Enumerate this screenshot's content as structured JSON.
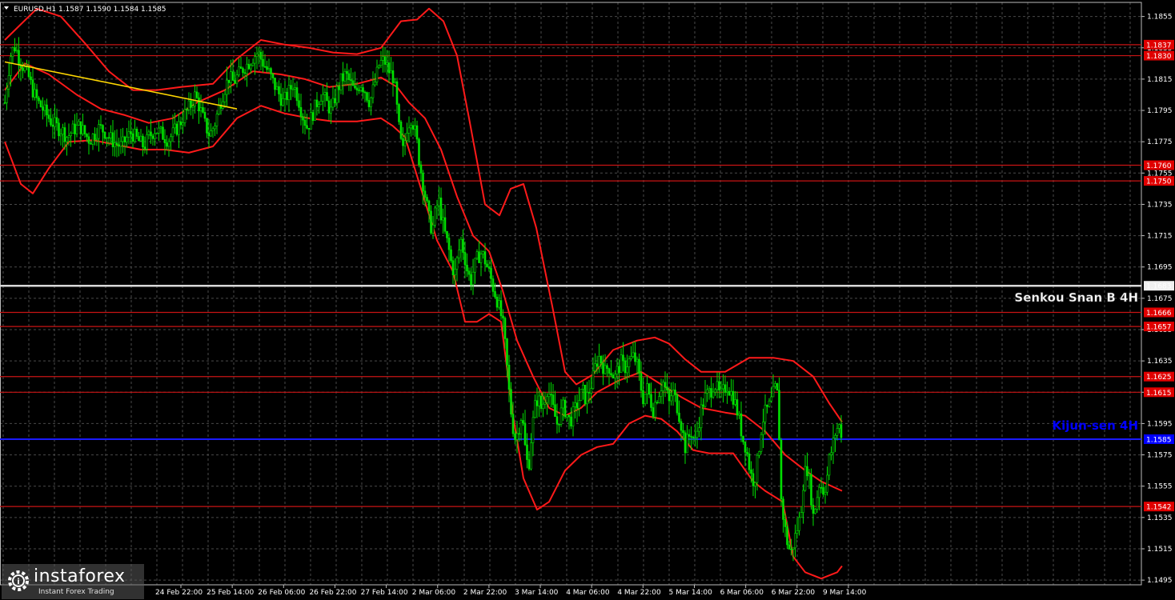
{
  "header": {
    "label": "EURUSD,H1  1.1587 1.1590 1.1584 1.1585",
    "menu_icon": "triangle-down-icon"
  },
  "colors": {
    "background": "#000000",
    "grid": "#4a4a4a",
    "candles": "#00e000",
    "bands": "#ff1a1a",
    "levels": "#c81414",
    "trendline": "#ffd700",
    "senkou": "#d9d9d9",
    "kijun": "#1a1aff",
    "badge_red": "#e00000",
    "badge_white": "#f0f0f0",
    "badge_blue": "#0000ff"
  },
  "watermark": {
    "brand": "instaforex",
    "tagline": "Instant Forex Trading",
    "icon": "instaforex-gear-logo-icon"
  },
  "chart_data": {
    "type": "candlestick",
    "symbol": "EURUSD",
    "timeframe": "H1",
    "ylim": [
      1.1492,
      1.1864
    ],
    "grid": true,
    "x_ticks": [
      "24 Feb 22:00",
      "25 Feb 14:00",
      "26 Feb 06:00",
      "26 Feb 22:00",
      "27 Feb 14:00",
      "2 Mar 06:00",
      "2 Mar 22:00",
      "3 Mar 14:00",
      "4 Mar 06:00",
      "4 Mar 22:00",
      "5 Mar 14:00",
      "6 Mar 06:00",
      "6 Mar 22:00",
      "9 Mar 14:00"
    ],
    "y_ticks": [
      "1.1855",
      "1.1835",
      "1.1815",
      "1.1795",
      "1.1775",
      "1.1755",
      "1.1735",
      "1.1715",
      "1.1695",
      "1.1675",
      "1.1655",
      "1.1635",
      "1.1615",
      "1.1595",
      "1.1575",
      "1.1555",
      "1.1535",
      "1.1515",
      "1.1495"
    ],
    "price_path": [
      [
        0,
        1.18
      ],
      [
        4,
        1.1818
      ],
      [
        8,
        1.1832
      ],
      [
        13,
        1.1836
      ],
      [
        18,
        1.1828
      ],
      [
        24,
        1.1822
      ],
      [
        30,
        1.1816
      ],
      [
        36,
        1.1806
      ],
      [
        42,
        1.18
      ],
      [
        50,
        1.1794
      ],
      [
        58,
        1.1788
      ],
      [
        66,
        1.1784
      ],
      [
        72,
        1.1782
      ],
      [
        78,
        1.1778
      ],
      [
        86,
        1.1783
      ],
      [
        94,
        1.1785
      ],
      [
        100,
        1.178
      ],
      [
        106,
        1.1776
      ],
      [
        112,
        1.178
      ],
      [
        118,
        1.1784
      ],
      [
        124,
        1.1782
      ],
      [
        130,
        1.1778
      ],
      [
        138,
        1.1774
      ],
      [
        146,
        1.1772
      ],
      [
        152,
        1.1777
      ],
      [
        158,
        1.1781
      ],
      [
        166,
        1.1776
      ],
      [
        174,
        1.1772
      ],
      [
        180,
        1.1778
      ],
      [
        188,
        1.1783
      ],
      [
        196,
        1.178
      ],
      [
        204,
        1.1776
      ],
      [
        210,
        1.178
      ],
      [
        218,
        1.1786
      ],
      [
        224,
        1.1792
      ],
      [
        232,
        1.1798
      ],
      [
        238,
        1.1805
      ],
      [
        244,
        1.1796
      ],
      [
        250,
        1.1786
      ],
      [
        256,
        1.1779
      ],
      [
        262,
        1.1786
      ],
      [
        268,
        1.1798
      ],
      [
        274,
        1.1808
      ],
      [
        280,
        1.1816
      ],
      [
        286,
        1.1813
      ],
      [
        292,
        1.1818
      ],
      [
        298,
        1.1822
      ],
      [
        304,
        1.1825
      ],
      [
        310,
        1.1829
      ],
      [
        316,
        1.1832
      ],
      [
        322,
        1.1826
      ],
      [
        330,
        1.1819
      ],
      [
        336,
        1.1812
      ],
      [
        342,
        1.1806
      ],
      [
        348,
        1.18
      ],
      [
        354,
        1.1806
      ],
      [
        360,
        1.1812
      ],
      [
        366,
        1.1804
      ],
      [
        372,
        1.1792
      ],
      [
        378,
        1.1784
      ],
      [
        384,
        1.1792
      ],
      [
        390,
        1.18
      ],
      [
        396,
        1.1806
      ],
      [
        402,
        1.18
      ],
      [
        408,
        1.1794
      ],
      [
        414,
        1.1806
      ],
      [
        420,
        1.1814
      ],
      [
        426,
        1.1818
      ],
      [
        432,
        1.1812
      ],
      [
        438,
        1.1806
      ],
      [
        444,
        1.1813
      ],
      [
        450,
        1.1808
      ],
      [
        456,
        1.18
      ],
      [
        462,
        1.1812
      ],
      [
        468,
        1.1825
      ],
      [
        474,
        1.1827
      ],
      [
        480,
        1.182
      ],
      [
        486,
        1.1816
      ],
      [
        490,
        1.1796
      ],
      [
        494,
        1.1776
      ],
      [
        498,
        1.1768
      ],
      [
        502,
        1.1784
      ],
      [
        508,
        1.1791
      ],
      [
        514,
        1.1778
      ],
      [
        518,
        1.1762
      ],
      [
        522,
        1.175
      ],
      [
        526,
        1.1738
      ],
      [
        530,
        1.1726
      ],
      [
        534,
        1.1718
      ],
      [
        538,
        1.173
      ],
      [
        542,
        1.1738
      ],
      [
        546,
        1.1726
      ],
      [
        550,
        1.1716
      ],
      [
        554,
        1.1708
      ],
      [
        558,
        1.1697
      ],
      [
        562,
        1.169
      ],
      [
        566,
        1.1702
      ],
      [
        570,
        1.1712
      ],
      [
        574,
        1.1703
      ],
      [
        578,
        1.1692
      ],
      [
        582,
        1.1686
      ],
      [
        586,
        1.1694
      ],
      [
        590,
        1.17
      ],
      [
        594,
        1.1704
      ],
      [
        598,
        1.1702
      ],
      [
        602,
        1.1696
      ],
      [
        606,
        1.169
      ],
      [
        610,
        1.1682
      ],
      [
        614,
        1.1676
      ],
      [
        618,
        1.1668
      ],
      [
        622,
        1.166
      ],
      [
        626,
        1.164
      ],
      [
        630,
        1.1615
      ],
      [
        634,
        1.1595
      ],
      [
        638,
        1.1585
      ],
      [
        642,
        1.1592
      ],
      [
        646,
        1.1602
      ],
      [
        650,
        1.158
      ],
      [
        654,
        1.1565
      ],
      [
        658,
        1.1588
      ],
      [
        662,
        1.1605
      ],
      [
        666,
        1.1612
      ],
      [
        670,
        1.1605
      ],
      [
        674,
        1.161
      ],
      [
        678,
        1.1618
      ],
      [
        682,
        1.161
      ],
      [
        686,
        1.1602
      ],
      [
        690,
        1.1595
      ],
      [
        694,
        1.1601
      ],
      [
        698,
        1.1606
      ],
      [
        702,
        1.1601
      ],
      [
        706,
        1.1596
      ],
      [
        710,
        1.1601
      ],
      [
        714,
        1.1606
      ],
      [
        718,
        1.1611
      ],
      [
        722,
        1.1616
      ],
      [
        726,
        1.161
      ],
      [
        730,
        1.1616
      ],
      [
        734,
        1.1622
      ],
      [
        738,
        1.1632
      ],
      [
        742,
        1.1638
      ],
      [
        746,
        1.1634
      ],
      [
        750,
        1.1628
      ],
      [
        754,
        1.1632
      ],
      [
        758,
        1.1628
      ],
      [
        762,
        1.1624
      ],
      [
        766,
        1.163
      ],
      [
        770,
        1.1634
      ],
      [
        774,
        1.163
      ],
      [
        778,
        1.1634
      ],
      [
        782,
        1.1636
      ],
      [
        786,
        1.1638
      ],
      [
        790,
        1.1632
      ],
      [
        794,
        1.162
      ],
      [
        798,
        1.161
      ],
      [
        802,
        1.1618
      ],
      [
        806,
        1.1611
      ],
      [
        810,
        1.1604
      ],
      [
        814,
        1.1611
      ],
      [
        818,
        1.1616
      ],
      [
        822,
        1.1622
      ],
      [
        826,
        1.1616
      ],
      [
        830,
        1.1608
      ],
      [
        834,
        1.1616
      ],
      [
        838,
        1.161
      ],
      [
        842,
        1.1602
      ],
      [
        846,
        1.1592
      ],
      [
        850,
        1.158
      ],
      [
        854,
        1.1586
      ],
      [
        858,
        1.159
      ],
      [
        862,
        1.1582
      ],
      [
        866,
        1.1593
      ],
      [
        870,
        1.1604
      ],
      [
        874,
        1.1611
      ],
      [
        878,
        1.1614
      ],
      [
        882,
        1.1616
      ],
      [
        886,
        1.1621
      ],
      [
        890,
        1.1617
      ],
      [
        894,
        1.1612
      ],
      [
        898,
        1.1616
      ],
      [
        902,
        1.162
      ],
      [
        906,
        1.1616
      ],
      [
        910,
        1.1612
      ],
      [
        914,
        1.1605
      ],
      [
        918,
        1.1596
      ],
      [
        922,
        1.1585
      ],
      [
        926,
        1.158
      ],
      [
        930,
        1.1568
      ],
      [
        934,
        1.1558
      ],
      [
        938,
        1.1562
      ],
      [
        942,
        1.1578
      ],
      [
        946,
        1.1596
      ],
      [
        950,
        1.1602
      ],
      [
        954,
        1.1605
      ],
      [
        958,
        1.161
      ],
      [
        962,
        1.1618
      ],
      [
        966,
        1.1612
      ],
      [
        970,
        1.1546
      ],
      [
        974,
        1.153
      ],
      [
        978,
        1.1518
      ],
      [
        982,
        1.1512
      ],
      [
        986,
        1.152
      ],
      [
        990,
        1.1528
      ],
      [
        994,
        1.1536
      ],
      [
        998,
        1.156
      ],
      [
        1002,
        1.1568
      ],
      [
        1006,
        1.1555
      ],
      [
        1010,
        1.1536
      ],
      [
        1014,
        1.1546
      ],
      [
        1018,
        1.1558
      ],
      [
        1022,
        1.1552
      ],
      [
        1026,
        1.1556
      ],
      [
        1030,
        1.1572
      ],
      [
        1034,
        1.158
      ],
      [
        1038,
        1.159
      ],
      [
        1042,
        1.1594
      ],
      [
        1046,
        1.1588
      ]
    ],
    "bands": [
      [
        [
          0,
          1.184
        ],
        [
          40,
          1.186
        ],
        [
          70,
          1.1855
        ],
        [
          100,
          1.1838
        ],
        [
          130,
          1.182
        ],
        [
          160,
          1.1808
        ],
        [
          190,
          1.1808
        ],
        [
          220,
          1.181
        ],
        [
          260,
          1.1812
        ],
        [
          290,
          1.1828
        ],
        [
          320,
          1.184
        ],
        [
          350,
          1.1837
        ],
        [
          380,
          1.1835
        ],
        [
          410,
          1.1832
        ],
        [
          440,
          1.1831
        ],
        [
          470,
          1.1835
        ],
        [
          495,
          1.1852
        ],
        [
          515,
          1.1853
        ],
        [
          530,
          1.186
        ],
        [
          548,
          1.1852
        ],
        [
          565,
          1.183
        ],
        [
          580,
          1.179
        ],
        [
          600,
          1.1735
        ],
        [
          618,
          1.1728
        ],
        [
          632,
          1.1745
        ],
        [
          648,
          1.1748
        ],
        [
          664,
          1.172
        ],
        [
          684,
          1.167
        ],
        [
          700,
          1.1628
        ],
        [
          714,
          1.162
        ],
        [
          734,
          1.1626
        ],
        [
          760,
          1.1642
        ],
        [
          790,
          1.1648
        ],
        [
          812,
          1.165
        ],
        [
          830,
          1.1646
        ],
        [
          850,
          1.1636
        ],
        [
          870,
          1.1628
        ],
        [
          900,
          1.1628
        ],
        [
          930,
          1.1637
        ],
        [
          960,
          1.1637
        ],
        [
          985,
          1.1635
        ],
        [
          1010,
          1.1625
        ],
        [
          1030,
          1.1608
        ],
        [
          1046,
          1.1596
        ]
      ],
      [
        [
          0,
          1.1808
        ],
        [
          25,
          1.1825
        ],
        [
          55,
          1.1818
        ],
        [
          90,
          1.1805
        ],
        [
          120,
          1.1796
        ],
        [
          150,
          1.1792
        ],
        [
          180,
          1.1787
        ],
        [
          210,
          1.179
        ],
        [
          240,
          1.18
        ],
        [
          275,
          1.1808
        ],
        [
          310,
          1.182
        ],
        [
          345,
          1.1818
        ],
        [
          375,
          1.1815
        ],
        [
          405,
          1.181
        ],
        [
          440,
          1.1812
        ],
        [
          470,
          1.1816
        ],
        [
          490,
          1.181
        ],
        [
          505,
          1.18
        ],
        [
          525,
          1.179
        ],
        [
          545,
          1.177
        ],
        [
          565,
          1.174
        ],
        [
          585,
          1.1715
        ],
        [
          605,
          1.1705
        ],
        [
          622,
          1.168
        ],
        [
          640,
          1.1648
        ],
        [
          660,
          1.1625
        ],
        [
          680,
          1.1605
        ],
        [
          700,
          1.16
        ],
        [
          720,
          1.1605
        ],
        [
          740,
          1.1615
        ],
        [
          765,
          1.1622
        ],
        [
          795,
          1.1628
        ],
        [
          820,
          1.162
        ],
        [
          845,
          1.1612
        ],
        [
          870,
          1.1605
        ],
        [
          900,
          1.1602
        ],
        [
          925,
          1.16
        ],
        [
          950,
          1.159
        ],
        [
          975,
          1.1575
        ],
        [
          1000,
          1.1565
        ],
        [
          1020,
          1.1558
        ],
        [
          1046,
          1.1552
        ]
      ],
      [
        [
          0,
          1.1775
        ],
        [
          20,
          1.1748
        ],
        [
          35,
          1.1742
        ],
        [
          55,
          1.1758
        ],
        [
          80,
          1.1775
        ],
        [
          110,
          1.1776
        ],
        [
          140,
          1.1773
        ],
        [
          170,
          1.177
        ],
        [
          200,
          1.177
        ],
        [
          230,
          1.1768
        ],
        [
          260,
          1.1772
        ],
        [
          290,
          1.179
        ],
        [
          320,
          1.1798
        ],
        [
          350,
          1.1793
        ],
        [
          380,
          1.179
        ],
        [
          410,
          1.1788
        ],
        [
          440,
          1.1788
        ],
        [
          470,
          1.179
        ],
        [
          485,
          1.1785
        ],
        [
          500,
          1.1778
        ],
        [
          520,
          1.1745
        ],
        [
          540,
          1.1712
        ],
        [
          560,
          1.1692
        ],
        [
          575,
          1.166
        ],
        [
          590,
          1.166
        ],
        [
          605,
          1.1665
        ],
        [
          620,
          1.166
        ],
        [
          635,
          1.16
        ],
        [
          648,
          1.156
        ],
        [
          665,
          1.154
        ],
        [
          680,
          1.1545
        ],
        [
          700,
          1.1565
        ],
        [
          720,
          1.1575
        ],
        [
          740,
          1.158
        ],
        [
          760,
          1.1582
        ],
        [
          780,
          1.1595
        ],
        [
          800,
          1.16
        ],
        [
          820,
          1.1598
        ],
        [
          840,
          1.159
        ],
        [
          860,
          1.1578
        ],
        [
          880,
          1.1576
        ],
        [
          910,
          1.1576
        ],
        [
          935,
          1.1558
        ],
        [
          950,
          1.1552
        ],
        [
          972,
          1.1545
        ],
        [
          985,
          1.151
        ],
        [
          1000,
          1.15
        ],
        [
          1020,
          1.1496
        ],
        [
          1040,
          1.15
        ],
        [
          1046,
          1.1504
        ]
      ]
    ],
    "trendline": [
      [
        0,
        1.1826
      ],
      [
        290,
        1.1796
      ]
    ],
    "levels": [
      {
        "value": 1.1837,
        "label": "1.1837"
      },
      {
        "value": 1.183,
        "label": "1.1830"
      },
      {
        "value": 1.176,
        "label": "1.1760"
      },
      {
        "value": 1.175,
        "label": "1.1750"
      },
      {
        "value": 1.1666,
        "label": "1.1666"
      },
      {
        "value": 1.1657,
        "label": "1.1657"
      },
      {
        "value": 1.1625,
        "label": "1.1625"
      },
      {
        "value": 1.1615,
        "label": "1.1615"
      },
      {
        "value": 1.1542,
        "label": "1.1542"
      }
    ],
    "senkou_span_b": {
      "value": 1.1683,
      "label": "1.1683",
      "name": "Senkou Snan B 4H"
    },
    "kijun_sen": {
      "value": 1.1585,
      "label": "1.1585",
      "name": "Kijun-sen 4H"
    }
  }
}
